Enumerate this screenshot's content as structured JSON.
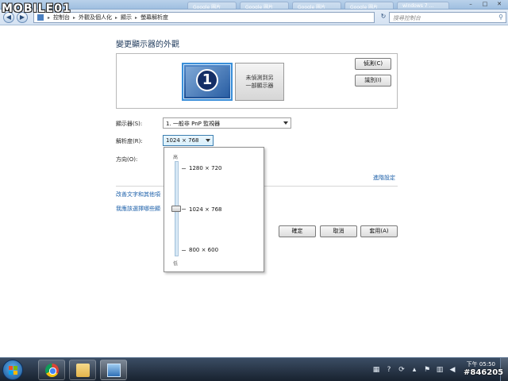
{
  "logo": {
    "text": "MOBILE01"
  },
  "browser_tabs": [
    "Google 圖片",
    "Google 圖片",
    "Google 圖片",
    "Google 圖片",
    "windows 7 ..."
  ],
  "breadcrumb": {
    "items": [
      "控制台",
      "外觀及個人化",
      "顯示",
      "螢幕解析度"
    ]
  },
  "search": {
    "placeholder": "搜尋控制台"
  },
  "page": {
    "title": "變更顯示器的外觀"
  },
  "preview": {
    "monitor1_number": "1",
    "monitor2_line1": "未偵測到另",
    "monitor2_line2": "一部顯示器",
    "detect_button": "偵測(C)",
    "identify_button": "識別(I)"
  },
  "display": {
    "label": "顯示器(S):",
    "value": "1. 一般非 PnP 監視器"
  },
  "resolution": {
    "label": "解析度(R):",
    "value": "1024 × 768",
    "high_label": "高",
    "low_label": "低",
    "options": [
      "1280 × 720",
      "1024 × 768",
      "800 × 600"
    ],
    "selected_index": 1
  },
  "orientation": {
    "label": "方向(O):"
  },
  "advanced_settings": {
    "label": "進階設定"
  },
  "links": {
    "text_size": "改善文字和其他項",
    "which_settings": "我應該選擇哪些顯"
  },
  "buttons": {
    "ok": "確定",
    "cancel": "取消",
    "apply": "套用(A)"
  },
  "taskbar": {
    "apps": [
      "chrome-icon",
      "folder-icon",
      "display-settings-icon"
    ]
  },
  "clock": {
    "ampm_time": "下午 05:50"
  },
  "watermark": {
    "code": "#846205"
  }
}
